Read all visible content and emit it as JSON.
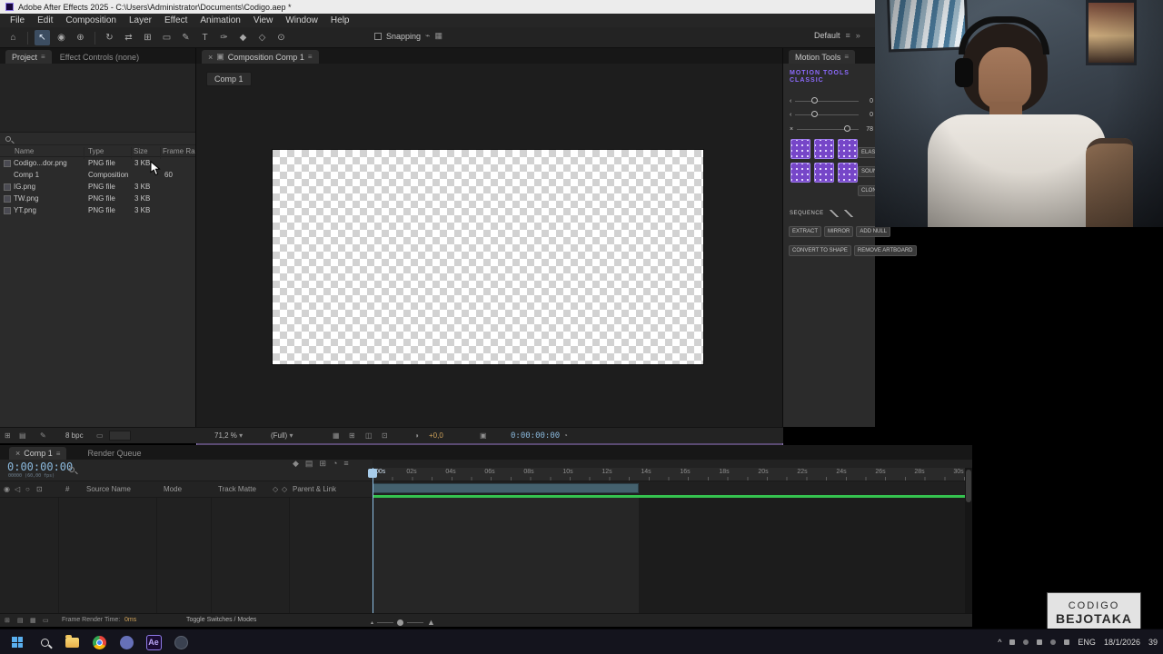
{
  "titlebar": {
    "title": "Adobe After Effects 2025 - C:\\Users\\Administrator\\Documents\\Codigo.aep *"
  },
  "menubar": {
    "items": [
      "File",
      "Edit",
      "Composition",
      "Layer",
      "Effect",
      "Animation",
      "View",
      "Window",
      "Help"
    ]
  },
  "toolbar": {
    "snapping_label": "Snapping",
    "workspace_label": "Default"
  },
  "project": {
    "tab_project": "Project",
    "tab_effect_controls": "Effect Controls (none)",
    "columns": {
      "name": "Name",
      "type": "Type",
      "size": "Size",
      "frame_rate": "Frame Ra"
    },
    "rows": [
      {
        "name": "Codigo...dor.png",
        "type": "PNG file",
        "size": "3 KB",
        "frame_rate": ""
      },
      {
        "name": "Comp 1",
        "type": "Composition",
        "size": "",
        "frame_rate": "60"
      },
      {
        "name": "IG.png",
        "type": "PNG file",
        "size": "3 KB",
        "frame_rate": ""
      },
      {
        "name": "TW.png",
        "type": "PNG file",
        "size": "3 KB",
        "frame_rate": ""
      },
      {
        "name": "YT.png",
        "type": "PNG file",
        "size": "3 KB",
        "frame_rate": ""
      }
    ],
    "bpc": "8 bpc"
  },
  "comp": {
    "panel_tab": "Composition Comp 1",
    "comp_chip": "Comp 1",
    "zoom": "71,2 %",
    "resolution": "(Full)",
    "exposure": "+0,0",
    "timecode": "0:00:00:00"
  },
  "motion_tools": {
    "panel_tab": "Motion Tools",
    "brand_line1": "MOTION TOOLS",
    "brand_line2": "CLASSIC",
    "slider_values": [
      "0",
      "0",
      "78"
    ],
    "side_buttons": [
      "ELAST",
      "SOUN",
      "CLON"
    ],
    "sequence_label": "SEQUENCE",
    "row_buttons": [
      "EXTRACT",
      "MIRROR",
      "ADD NULL"
    ],
    "bottom_buttons": [
      "CONVERT TO SHAPE",
      "REMOVE ARTBOARD"
    ]
  },
  "timeline": {
    "tab_comp": "Comp 1",
    "tab_render_queue": "Render Queue",
    "timecode": "0:00:00:00",
    "timecode_sub": "00000 (60,00 fps)",
    "columns": {
      "number": "#",
      "source_name": "Source Name",
      "mode": "Mode",
      "track_matte": "Track Matte",
      "parent_link": "Parent & Link"
    },
    "ruler": [
      ":00s",
      "02s",
      "04s",
      "06s",
      "08s",
      "10s",
      "12s",
      "14s",
      "16s",
      "18s",
      "20s",
      "22s",
      "24s",
      "26s",
      "28s",
      "30s"
    ],
    "render_time_label": "Frame Render Time:",
    "render_time_value": "0ms",
    "toggle_label": "Toggle Switches / Modes"
  },
  "overlay_badge": {
    "line1": "CODIGO",
    "line2": "BEJOTAKA"
  },
  "taskbar": {
    "ae_label": "Ae",
    "language": "ENG",
    "date": "18/1/2026",
    "notification_count": "39"
  },
  "colors": {
    "cache_green": "#35c24f",
    "work_area_teal": "#44616e",
    "timecode_blue": "#8ab8dc",
    "brand_purple": "#8d6bff"
  }
}
